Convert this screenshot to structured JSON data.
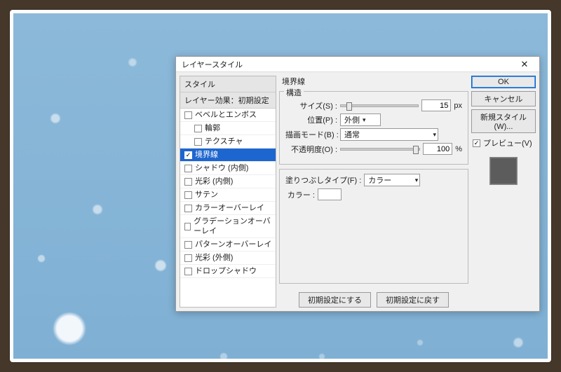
{
  "dialog": {
    "title": "レイヤースタイル",
    "close_glyph": "✕"
  },
  "styles_panel": {
    "header_styles": "スタイル",
    "header_blend": "レイヤー効果：初期設定",
    "items": [
      {
        "label": "ベベルとエンボス",
        "checked": false,
        "indent": false
      },
      {
        "label": "輪郭",
        "checked": false,
        "indent": true
      },
      {
        "label": "テクスチャ",
        "checked": false,
        "indent": true
      },
      {
        "label": "境界線",
        "checked": true,
        "indent": false,
        "selected": true
      },
      {
        "label": "シャドウ (内側)",
        "checked": false,
        "indent": false
      },
      {
        "label": "光彩 (内側)",
        "checked": false,
        "indent": false
      },
      {
        "label": "サテン",
        "checked": false,
        "indent": false
      },
      {
        "label": "カラーオーバーレイ",
        "checked": false,
        "indent": false
      },
      {
        "label": "グラデーションオーバーレイ",
        "checked": false,
        "indent": false
      },
      {
        "label": "パターンオーバーレイ",
        "checked": false,
        "indent": false
      },
      {
        "label": "光彩 (外側)",
        "checked": false,
        "indent": false
      },
      {
        "label": "ドロップシャドウ",
        "checked": false,
        "indent": false
      }
    ]
  },
  "stroke": {
    "group_title": "境界線",
    "structure_title": "構造",
    "size_label": "サイズ(S) :",
    "size_value": "15",
    "size_unit": "px",
    "position_label": "位置(P) :",
    "position_value": "外側",
    "blend_label": "描画モード(B) :",
    "blend_value": "通常",
    "opacity_label": "不透明度(O) :",
    "opacity_value": "100",
    "opacity_unit": "%",
    "filltype_label": "塗りつぶしタイプ(F) :",
    "filltype_value": "カラー",
    "color_label": "カラー :",
    "color_hex": "#ffffff",
    "btn_default": "初期設定にする",
    "btn_reset": "初期設定に戻す"
  },
  "right": {
    "ok": "OK",
    "cancel": "キャンセル",
    "new_style": "新規スタイル(W)...",
    "preview_label": "プレビュー(V)",
    "preview_checked": true
  }
}
